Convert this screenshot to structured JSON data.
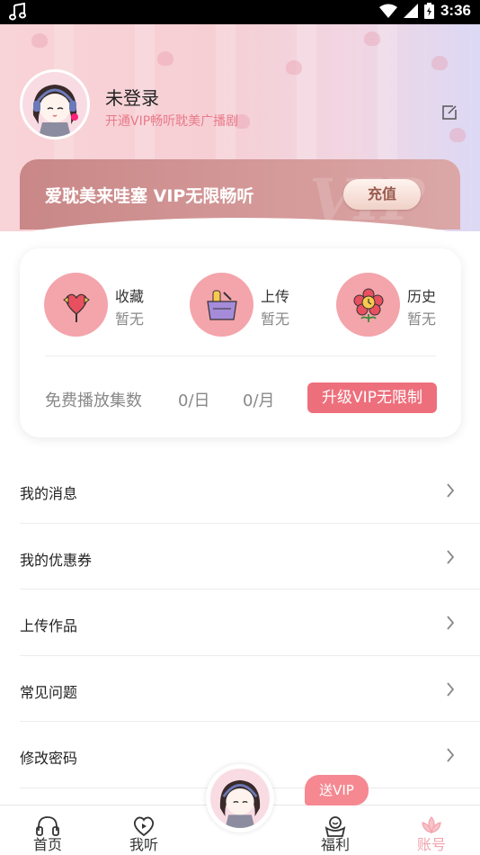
{
  "status_bar": {
    "time": "3:36",
    "music_icon": "music-note-icon",
    "wifi_icon": "wifi-icon",
    "signal_icon": "signal-icon",
    "battery_icon": "battery-icon"
  },
  "profile": {
    "name": "未登录",
    "subtitle": "开通VIP畅听耽美广播剧",
    "edit_icon": "edit-icon"
  },
  "vip_banner": {
    "text": "爱耽美来哇塞 VIP无限畅听",
    "recharge_label": "充值"
  },
  "stats": [
    {
      "label": "收藏",
      "value": "暂无",
      "icon": "heart-candy-icon"
    },
    {
      "label": "上传",
      "value": "暂无",
      "icon": "basket-icon"
    },
    {
      "label": "历史",
      "value": "暂无",
      "icon": "flower-clock-icon"
    }
  ],
  "quota": {
    "label": "免费播放集数",
    "per_day": "0/日",
    "per_month": "0/月",
    "upgrade_label": "升级VIP无限制"
  },
  "menu": [
    {
      "label": "我的消息"
    },
    {
      "label": "我的优惠券"
    },
    {
      "label": "上传作品"
    },
    {
      "label": "常见问题"
    },
    {
      "label": "修改密码"
    }
  ],
  "bottom_nav": [
    {
      "label": "首页",
      "icon": "headphones-icon"
    },
    {
      "label": "我听",
      "icon": "heart-play-icon"
    },
    {
      "label": "福利",
      "icon": "gift-face-icon"
    },
    {
      "label": "账号",
      "icon": "lotus-icon",
      "active": true
    }
  ],
  "send_vip_label": "送VIP",
  "colors": {
    "accent": "#ee6f7c",
    "pink_light": "#f4a4ab",
    "active_nav": "#f2a3ad"
  }
}
